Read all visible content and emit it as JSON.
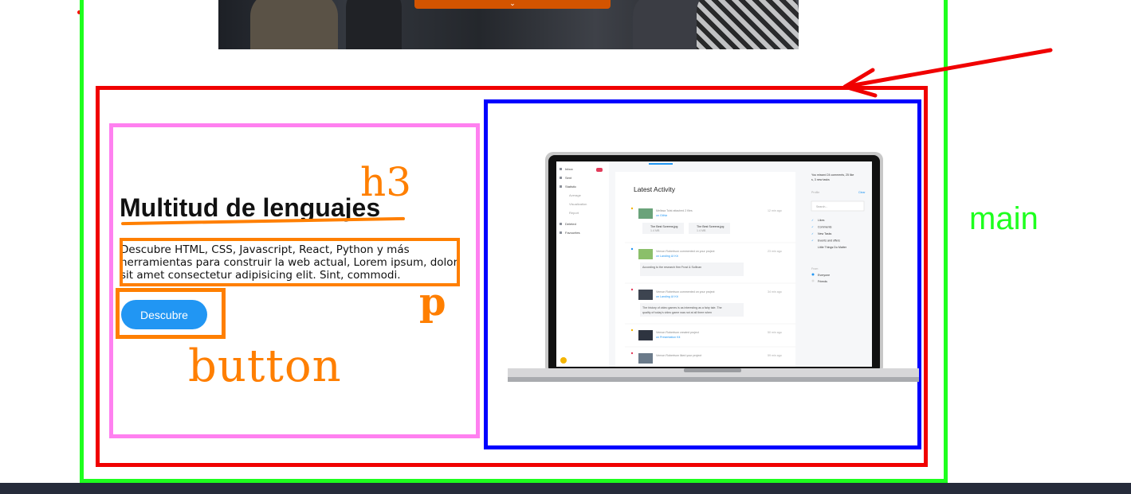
{
  "hero": {
    "cta_icon": "chevron-down-icon",
    "cta_glyph": "⌄"
  },
  "section": {
    "heading": "Multitud de lenguajes",
    "paragraph": "Descubre HTML, CSS, Javascript, React, Python y más herramientas para construir la web actual, Lorem ipsum, dolor sit amet consectetur adipisicing elit. Sint, commodi.",
    "button_label": "Descubre"
  },
  "screenshot": {
    "title": "Latest Activity",
    "sidebar_items": [
      "Inbox",
      "Sent",
      "Statistic",
      "Average",
      "Visualization",
      "Report",
      "Deleted",
      "Favourites"
    ],
    "activity_items": [
      {
        "text": "Melissa Tolst attached 2 files",
        "link": "Githiz",
        "time": "12 min ago"
      },
      {
        "text": "Vernon Robertson commented on your project",
        "link": "Landing UI Kit",
        "time": "23 min ago",
        "comment": "According to the research firm Frost & Sullivan"
      },
      {
        "text": "Vernon Robertson commented on your project",
        "link": "Landing UI Kit",
        "time": "34 min ago",
        "comment": "The history of video games is as interesting as a fairy tale. The quality of today's video game was not at all there when"
      },
      {
        "text": "Vernon Robertson created project",
        "link": "Presentation Kit",
        "time": "50 min ago"
      },
      {
        "text": "Vernon Robertson liked your project",
        "link": "",
        "time": "59 min ago"
      }
    ],
    "files": [
      {
        "name": "The Best Screens.jpg",
        "size": "1.4 MB"
      },
      {
        "name": "The Best Screens.jpg",
        "size": "1.4 MB"
      }
    ],
    "right_panel": {
      "summary": "You missed 24 comments, 25 likes, 3 new tasks",
      "profile_label": "Profile",
      "clear_label": "Clear",
      "search_placeholder": "Search...",
      "checks": [
        "Likes",
        "Comments",
        "New Tasks",
        "Events and offers",
        "Little Things Do Matter"
      ],
      "from_label": "From",
      "radios": [
        "Everyone",
        "Friends"
      ]
    }
  },
  "annotations": {
    "h3": "h3",
    "p": "p",
    "button": "button",
    "main": "main"
  },
  "colors": {
    "main_box": "#1eff1e",
    "section_box": "#f00000",
    "text_box": "#ff80f0",
    "image_box": "#0000ff",
    "annotation": "#ff7f00",
    "button_bg": "#2196f3",
    "hero_cta": "#d35400",
    "footer": "#262b3a"
  }
}
